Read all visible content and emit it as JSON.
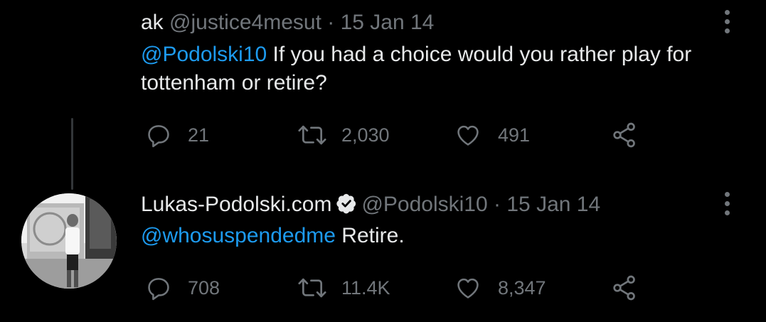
{
  "tweet1": {
    "name": "ak",
    "handle": "@justice4mesut",
    "separator": "·",
    "date": "15 Jan 14",
    "mention": "@Podolski10",
    "text": " If you had a choice would you rather play for tottenham or retire?",
    "replies": "21",
    "retweets": "2,030",
    "likes": "491"
  },
  "tweet2": {
    "name": "Lukas-Podolski.com",
    "handle": "@Podolski10",
    "separator": "·",
    "date": "15 Jan 14",
    "mention": "@whosuspendedme",
    "text": " Retire.",
    "replies": "708",
    "retweets": "11.4K",
    "likes": "8,347"
  },
  "icons": {
    "reply": "reply-icon",
    "retweet": "retweet-icon",
    "like": "heart-icon",
    "share": "share-icon",
    "more": "more-vertical-icon",
    "verified": "verified-badge-icon"
  },
  "colors": {
    "background": "#000000",
    "text": "#e7e9ea",
    "muted": "#71767b",
    "link": "#1d9bf0"
  }
}
